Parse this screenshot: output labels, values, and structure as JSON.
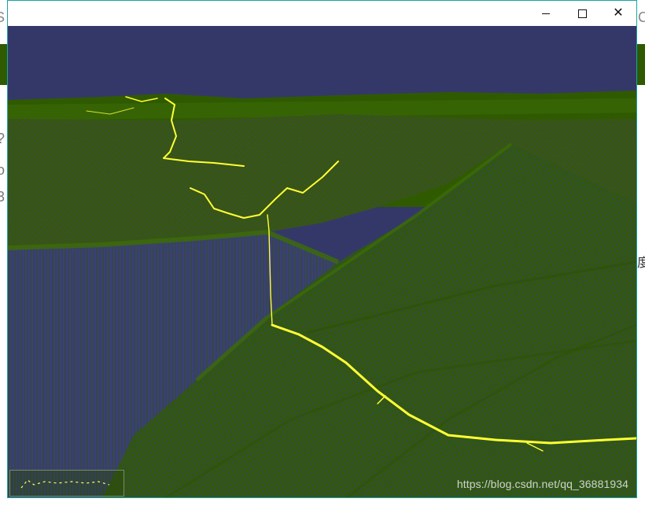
{
  "window": {
    "buttons": {
      "minimize_icon": "minimize-icon",
      "maximize_icon": "maximize-icon",
      "close_icon": "close-icon",
      "close_glyph": "✕"
    }
  },
  "scene": {
    "sky_color": "#343869",
    "terrain_color": "#2f5a00",
    "track_color": "#ffff33"
  },
  "watermark": {
    "text": "https://blog.csdn.net/qq_36881934"
  }
}
